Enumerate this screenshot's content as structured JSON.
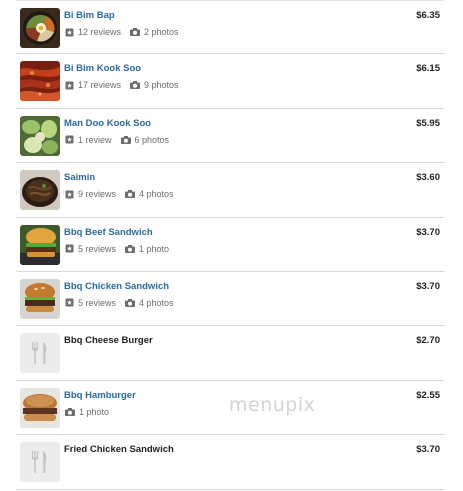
{
  "menu_items": [
    {
      "name": "Bi Bim Bap",
      "reviews": "12 reviews",
      "photos": "2 photos",
      "price": "$6.35",
      "thumb": "bibimbap"
    },
    {
      "name": "Bi Bim Kook Soo",
      "reviews": "17 reviews",
      "photos": "9 photos",
      "price": "$6.15",
      "thumb": "noodles"
    },
    {
      "name": "Man Doo Kook Soo",
      "reviews": "1 review",
      "photos": "6 photos",
      "price": "$5.95",
      "thumb": "soup"
    },
    {
      "name": "Saimin",
      "reviews": "9 reviews",
      "photos": "4 photos",
      "price": "$3.60",
      "thumb": "saimin"
    },
    {
      "name": "Bbq Beef Sandwich",
      "reviews": "5 reviews",
      "photos": "1 photo",
      "price": "$3.70",
      "thumb": "sandwich"
    },
    {
      "name": "Bbq Chicken Sandwich",
      "reviews": "5 reviews",
      "photos": "4 photos",
      "price": "$3.70",
      "thumb": "burger"
    },
    {
      "name": "Bbq Cheese Burger",
      "reviews": "",
      "photos": "",
      "price": "$2.70",
      "thumb": "placeholder"
    },
    {
      "name": "Bbq Hamburger",
      "reviews": "",
      "photos": "1 photo",
      "price": "$2.55",
      "thumb": "hamburger"
    },
    {
      "name": "Fried Chicken Sandwich",
      "reviews": "",
      "photos": "",
      "price": "$3.70",
      "thumb": "placeholder"
    }
  ],
  "icons": {
    "review": "review-icon",
    "photo": "camera-icon",
    "placeholder": "fork-knife-icon"
  },
  "colors": {
    "link": "#2a6aa3",
    "text": "#222222",
    "meta": "#6d6d6d",
    "divider": "#d9d9d9"
  },
  "watermark": "menupix"
}
